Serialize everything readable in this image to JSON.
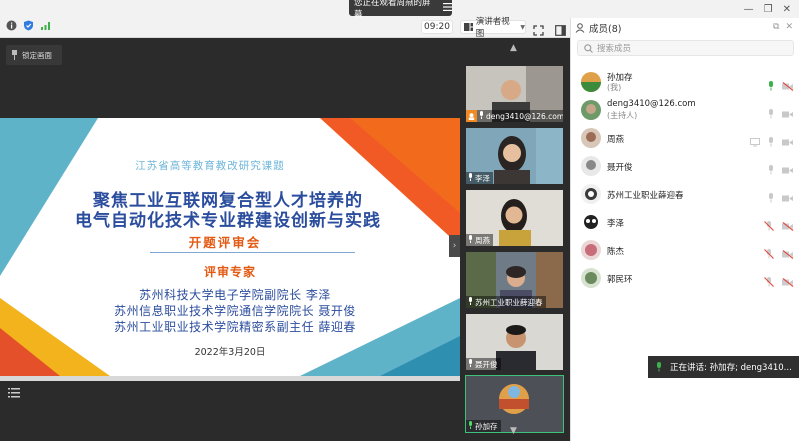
{
  "topbar": {
    "share_banner": "您正在观看周燕的屏幕",
    "time": "09:20",
    "view_mode": "演讲者视图",
    "window_controls": [
      "—",
      "❐",
      "✕"
    ]
  },
  "screen": {
    "lock_label": "锁定画面",
    "slide": {
      "subtitle": "江苏省高等教育教改研究课题",
      "title_line1": "聚焦工业互联网复合型人才培养的",
      "title_line2": "电气自动化技术专业群建设创新与实践",
      "meeting": "开题评审会",
      "experts_heading": "评审专家",
      "experts": [
        "苏州科技大学电子学院副院长  李泽",
        "苏州信息职业技术学院通信学院院长  聂开俊",
        "苏州工业职业技术学院精密系副主任  薛迎春"
      ],
      "date": "2022年3月20日",
      "colors": {
        "blue": "#2b4d9d",
        "orange": "#e35a14",
        "teal": "#5fb3c8",
        "yellow": "#f2b31c"
      }
    }
  },
  "videos": [
    {
      "label": "deng3410@126.com",
      "host": true
    },
    {
      "label": "李泽",
      "host": false
    },
    {
      "label": "周燕",
      "host": false
    },
    {
      "label": "苏州工业职业薛迎春",
      "host": false
    },
    {
      "label": "聂开俊",
      "host": false
    },
    {
      "label": "孙加存",
      "host": false
    }
  ],
  "members": {
    "title": "成员(8)",
    "search_placeholder": "搜索成员",
    "list": [
      {
        "name": "孙加存",
        "sub": "(我)",
        "mic": "on-green",
        "cam": "off"
      },
      {
        "name": "deng3410@126.com",
        "sub": "(主持人)",
        "mic": "on",
        "cam": "on"
      },
      {
        "name": "周燕",
        "sub": "",
        "mic": "on",
        "cam": "on",
        "share": true
      },
      {
        "name": "聂开俊",
        "sub": "",
        "mic": "on",
        "cam": "on"
      },
      {
        "name": "苏州工业职业薛迎春",
        "sub": "",
        "mic": "on",
        "cam": "on"
      },
      {
        "name": "李泽",
        "sub": "",
        "mic": "off",
        "cam": "off"
      },
      {
        "name": "陈杰",
        "sub": "",
        "mic": "off",
        "cam": "off"
      },
      {
        "name": "郭民环",
        "sub": "",
        "mic": "off",
        "cam": "off"
      }
    ]
  },
  "speaking": "正在讲话: 孙加存; deng3410..."
}
